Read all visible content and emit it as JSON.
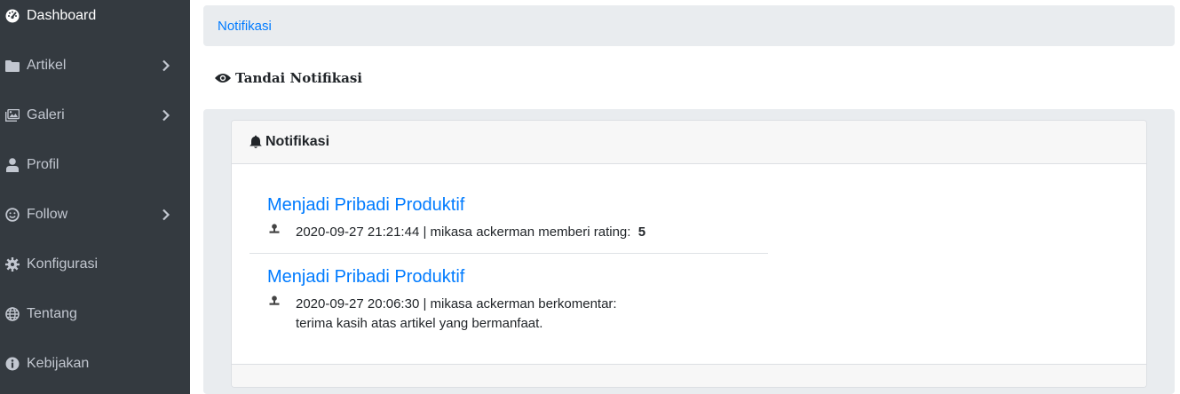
{
  "sidebar": {
    "items": [
      {
        "label": "Dashboard",
        "icon": "tachometer-icon",
        "active": true,
        "has_submenu": false
      },
      {
        "label": "Artikel",
        "icon": "folder-icon",
        "active": false,
        "has_submenu": true
      },
      {
        "label": "Galeri",
        "icon": "images-icon",
        "active": false,
        "has_submenu": true
      },
      {
        "label": "Profil",
        "icon": "user-icon",
        "active": false,
        "has_submenu": false
      },
      {
        "label": "Follow",
        "icon": "smile-icon",
        "active": false,
        "has_submenu": true
      },
      {
        "label": "Konfigurasi",
        "icon": "cog-icon",
        "active": false,
        "has_submenu": false
      },
      {
        "label": "Tentang",
        "icon": "globe-icon",
        "active": false,
        "has_submenu": false
      },
      {
        "label": "Kebijakan",
        "icon": "info-circle-icon",
        "active": false,
        "has_submenu": false
      }
    ]
  },
  "breadcrumb": {
    "label": "Notifikasi"
  },
  "mark_notifications": {
    "label": "Tandai Notifikasi",
    "icon": "eye-icon"
  },
  "card": {
    "title": "Notifikasi",
    "icon": "bell-icon"
  },
  "notifications": [
    {
      "title": "Menjadi Pribadi Produktif",
      "meta": "2020-09-27 21:21:44 | mikasa ackerman memberi rating:",
      "rating": "5"
    },
    {
      "title": "Menjadi Pribadi Produktif",
      "meta": "2020-09-27 20:06:30 | mikasa ackerman berkomentar:",
      "comment": "terima kasih atas artikel yang bermanfaat."
    }
  ],
  "colors": {
    "sidebar_bg": "#343a40",
    "link": "#007bff",
    "panel_bg": "#e9ecef"
  }
}
